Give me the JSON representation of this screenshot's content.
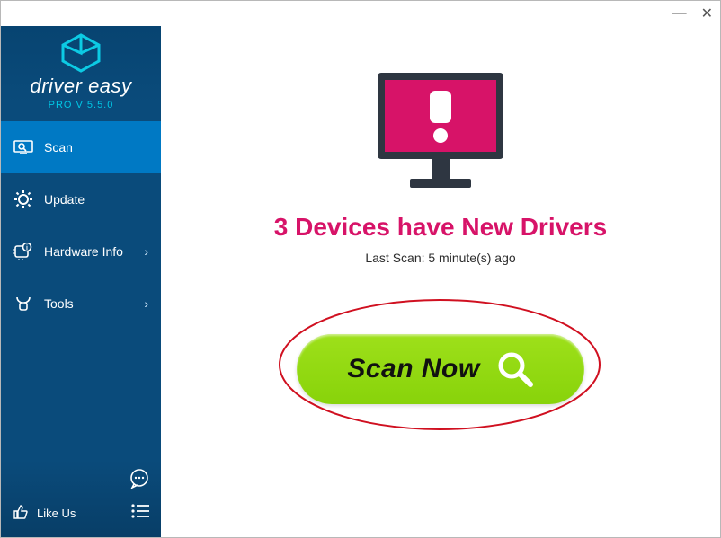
{
  "brand": {
    "name": "driver easy",
    "version": "PRO V 5.5.0"
  },
  "nav": {
    "scan": "Scan",
    "update": "Update",
    "hardware": "Hardware Info",
    "tools": "Tools"
  },
  "footer": {
    "like": "Like Us"
  },
  "main": {
    "headline": "3 Devices have New Drivers",
    "subline": "Last Scan: 5 minute(s) ago",
    "scan_label": "Scan Now"
  },
  "colors": {
    "accent": "#d71368",
    "scan": "#8fd60f",
    "sidebar": "#0a4b7b"
  }
}
